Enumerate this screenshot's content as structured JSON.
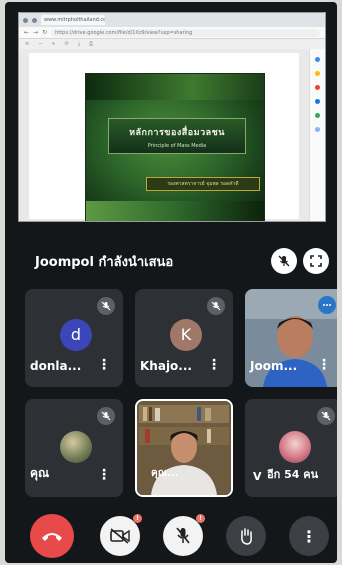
{
  "browser": {
    "tab_title": "www.mitrpholthailand.com/MitrPholMedia...",
    "url": "https://drive.google.com/file/d/1Xz9/view?usp=sharing"
  },
  "slide": {
    "title": "หลักการของสื่อมวลชน",
    "subtitle": "Principle of Mass Media",
    "author": "รองศาสตราจารย์ จุมพล รอดคำดี"
  },
  "presenter": {
    "label": "Joompol กำลังนำเสนอ"
  },
  "participants": [
    {
      "name": "donla...",
      "initial": "d",
      "avatar_color": "#3b46b8",
      "muted": true
    },
    {
      "name": "Khajo...",
      "initial": "K",
      "avatar_color": "#a07868",
      "muted": true
    },
    {
      "name": "Joom...",
      "speaking": true
    },
    {
      "name": "คุณ",
      "muted": true
    },
    {
      "name": "คุณ...",
      "muted": false
    },
    {
      "name": "V",
      "others_label": "อีก 54 คน",
      "muted": true
    }
  ],
  "controls": {
    "camera_badge": "!",
    "mic_badge": "!"
  },
  "colors": {
    "background": "#14171a",
    "tile": "#2d3034",
    "end_call": "#e84a4a",
    "white_button": "#f3f3f3",
    "dark_button": "#3c3f44"
  }
}
